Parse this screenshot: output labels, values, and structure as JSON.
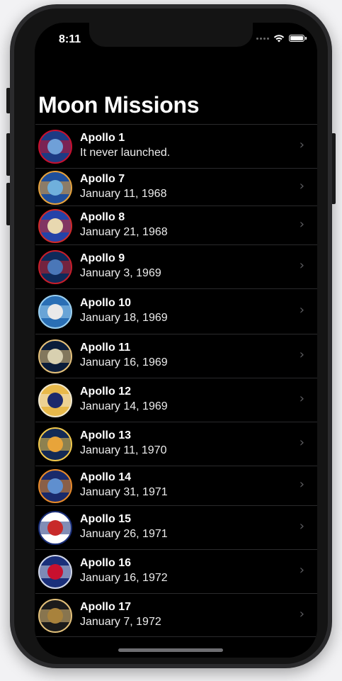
{
  "app": {
    "status_time": "8:11",
    "title": "Moon Missions"
  },
  "status_icons": [
    "signal-dots-icon",
    "wifi-icon",
    "battery-icon"
  ],
  "missions": [
    {
      "name": "Apollo 1",
      "date": "It never launched.",
      "patch": {
        "bg": "#1d3b84",
        "ring": "#c8102e",
        "inner": "#6fa0d8"
      }
    },
    {
      "name": "Apollo 7",
      "date": "January 11, 1968",
      "patch": {
        "bg": "#1f4f9c",
        "ring": "#e6a23c",
        "inner": "#6fb0dc"
      }
    },
    {
      "name": "Apollo 8",
      "date": "January 21, 1968",
      "patch": {
        "bg": "#2443a8",
        "ring": "#d02a2a",
        "inner": "#e8d8b0"
      }
    },
    {
      "name": "Apollo 9",
      "date": "January 3, 1969",
      "patch": {
        "bg": "#0e2a5a",
        "ring": "#c81e2a",
        "inner": "#4a77b8"
      }
    },
    {
      "name": "Apollo 10",
      "date": "January 18, 1969",
      "patch": {
        "bg": "#2a6fb5",
        "ring": "#9cd0f0",
        "inner": "#e9e9e9"
      }
    },
    {
      "name": "Apollo 11",
      "date": "January 16, 1969",
      "patch": {
        "bg": "#0b1d3a",
        "ring": "#e5c17a",
        "inner": "#d8d0b0"
      }
    },
    {
      "name": "Apollo 12",
      "date": "January 14, 1969",
      "patch": {
        "bg": "#e8b94a",
        "ring": "#f0e8d0",
        "inner": "#1c2a6b"
      }
    },
    {
      "name": "Apollo 13",
      "date": "January 11, 1970",
      "patch": {
        "bg": "#132a56",
        "ring": "#f2c94c",
        "inner": "#e8a43a"
      }
    },
    {
      "name": "Apollo 14",
      "date": "January 31, 1971",
      "patch": {
        "bg": "#1a2a6b",
        "ring": "#e88a2a",
        "inner": "#5f8fcf"
      }
    },
    {
      "name": "Apollo 15",
      "date": "January 26, 1971",
      "patch": {
        "bg": "#ffffff",
        "ring": "#1a2f7a",
        "inner": "#c82a2a"
      }
    },
    {
      "name": "Apollo 16",
      "date": "January 16, 1972",
      "patch": {
        "bg": "#1a2f7a",
        "ring": "#d0d6e8",
        "inner": "#c8102e"
      }
    },
    {
      "name": "Apollo 17",
      "date": "January 7, 1972",
      "patch": {
        "bg": "#1b1b1b",
        "ring": "#e2c07a",
        "inner": "#a8823c"
      }
    }
  ],
  "colors": {
    "background": "#000000",
    "text_primary": "#ffffff",
    "separator": "#2a2a2c",
    "chevron": "#5c5c60"
  }
}
